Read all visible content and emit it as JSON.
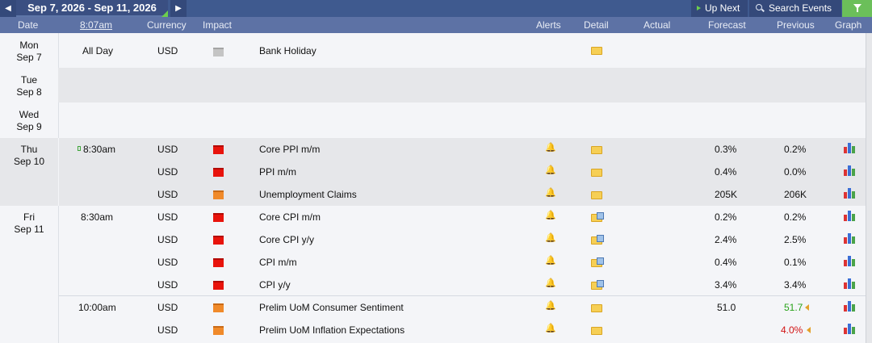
{
  "toolbar": {
    "prev_icon": "◀",
    "next_icon": "▶",
    "date_range": "Sep 7, 2026 - Sep 11, 2026",
    "up_next_label": "Up Next",
    "search_label": "Search Events",
    "filter_icon": "filter-icon"
  },
  "columns": {
    "date": "Date",
    "time": "8:07am",
    "currency": "Currency",
    "impact": "Impact",
    "alerts": "Alerts",
    "detail": "Detail",
    "actual": "Actual",
    "forecast": "Forecast",
    "previous": "Previous",
    "graph": "Graph"
  },
  "days": {
    "mon": {
      "dow": "Mon",
      "date": "Sep 7"
    },
    "tue": {
      "dow": "Tue",
      "date": "Sep 8"
    },
    "wed": {
      "dow": "Wed",
      "date": "Sep 9"
    },
    "thu": {
      "dow": "Thu",
      "date": "Sep 10"
    },
    "fri": {
      "dow": "Fri",
      "date": "Sep 11"
    }
  },
  "events": [
    {
      "time": "All Day",
      "currency": "USD",
      "impact": "holiday",
      "name": "Bank Holiday",
      "forecast": "",
      "previous": ""
    },
    {
      "time": "8:30am",
      "currency": "USD",
      "impact": "high",
      "name": "Core PPI m/m",
      "forecast": "0.3%",
      "previous": "0.2%"
    },
    {
      "time": "",
      "currency": "USD",
      "impact": "high",
      "name": "PPI m/m",
      "forecast": "0.4%",
      "previous": "0.0%"
    },
    {
      "time": "",
      "currency": "USD",
      "impact": "medium",
      "name": "Unemployment Claims",
      "forecast": "205K",
      "previous": "206K"
    },
    {
      "time": "8:30am",
      "currency": "USD",
      "impact": "high",
      "name": "Core CPI m/m",
      "forecast": "0.2%",
      "previous": "0.2%"
    },
    {
      "time": "",
      "currency": "USD",
      "impact": "high",
      "name": "Core CPI y/y",
      "forecast": "2.4%",
      "previous": "2.5%"
    },
    {
      "time": "",
      "currency": "USD",
      "impact": "high",
      "name": "CPI m/m",
      "forecast": "0.4%",
      "previous": "0.1%"
    },
    {
      "time": "",
      "currency": "USD",
      "impact": "high",
      "name": "CPI y/y",
      "forecast": "3.4%",
      "previous": "3.4%"
    },
    {
      "time": "10:00am",
      "currency": "USD",
      "impact": "medium",
      "name": "Prelim UoM Consumer Sentiment",
      "forecast": "51.0",
      "previous": "51.7"
    },
    {
      "time": "",
      "currency": "USD",
      "impact": "medium",
      "name": "Prelim UoM Inflation Expectations",
      "forecast": "",
      "previous": "4.0%"
    }
  ],
  "colors": {
    "header_bg": "#3f5a8f",
    "column_header_bg": "#5d72a5",
    "filter_bg": "#6bbf5a",
    "previous_better": "#2aa31b",
    "previous_worse": "#d21313"
  }
}
